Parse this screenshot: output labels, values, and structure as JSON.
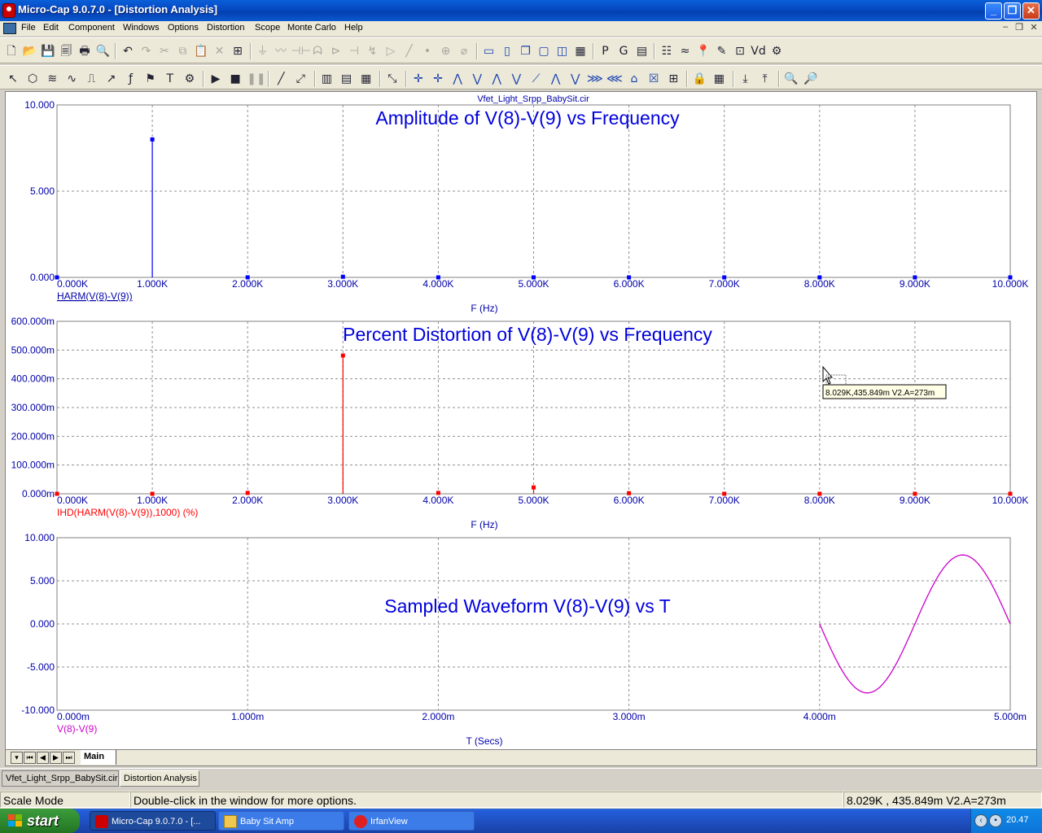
{
  "window": {
    "title": "Micro-Cap 9.0.7.0 - [Distortion Analysis]",
    "controls": {
      "minimize": "_",
      "maximize": "❐",
      "close": "✕"
    }
  },
  "menu": {
    "items": [
      "File",
      "Edit",
      "Component",
      "Windows",
      "Options",
      "Distortion",
      "Scope",
      "Monte Carlo",
      "Help"
    ],
    "mdi_controls": [
      "‒",
      "❐",
      "✕"
    ]
  },
  "toolbar1": {
    "icons": [
      "new-file-icon",
      "open-folder-icon",
      "save-icon",
      "save-all-icon",
      "print-icon",
      "print-preview-icon",
      "undo-icon",
      "redo-icon",
      "cut-icon",
      "copy-icon",
      "paste-icon",
      "delete-icon",
      "select-all-icon",
      "ground-icon",
      "resistor-icon",
      "capacitor-icon",
      "inductor-icon",
      "diode-icon",
      "battery-icon",
      "npn-icon",
      "opamp-icon",
      "wire-icon",
      "dot-icon",
      "source-icon",
      "probe-icon",
      "tile-horizontal-icon",
      "tile-vertical-icon",
      "cascade-icon",
      "window-icon",
      "window-split-icon",
      "calculator-icon",
      "properties-p-icon",
      "grid-g-icon",
      "window-list-icon",
      "netlist-icon",
      "waveform-icon",
      "pin-icon",
      "pencil-icon",
      "zoom-window-icon",
      "vd-icon",
      "settings-icon"
    ],
    "glyphs": [
      "🗋",
      "📂",
      "💾",
      "🗐",
      "🖶",
      "🔍",
      "↶",
      "↷",
      "✂",
      "⧉",
      "📋",
      "✕",
      "⊞",
      "⏚",
      "〰",
      "⊣⊢",
      "ᗣ",
      "⊳",
      "⊣",
      "↯",
      "▷",
      "╱",
      "•",
      "⊕",
      "⌀",
      "▭",
      "▯",
      "❐",
      "▢",
      "◫",
      "▦",
      "P",
      "G",
      "▤",
      "☷",
      "≈",
      "📍",
      "✎",
      "⊡",
      "Vd",
      "⚙"
    ]
  },
  "toolbar2": {
    "icons": [
      "select-arrow-icon",
      "component-icon",
      "waveform-ops-icon",
      "spectrum-icon",
      "step-icon",
      "analysis-icon",
      "fft-icon",
      "mode-icon",
      "text-icon",
      "properties-icon",
      "run-icon",
      "stop-icon",
      "pause-icon",
      "line-icon",
      "line-arrow-icon",
      "grid1-icon",
      "grid2-icon",
      "grid3-icon",
      "auto-scale-icon",
      "cursor1-icon",
      "cursor2-icon",
      "cursor3-icon",
      "cursor4-icon",
      "tracking-icon",
      "peak-icon",
      "valley-icon",
      "high-icon",
      "low-icon",
      "inflection-icon",
      "slope-icon",
      "top-icon",
      "bottom-icon",
      "global-icon",
      "lock-icon",
      "table-icon",
      "cursor-mode-icon",
      "data-point-icon",
      "zoom-in-icon",
      "zoom-out-icon"
    ],
    "glyphs": [
      "↖",
      "⬡",
      "≋",
      "∿",
      "⎍",
      "↗",
      "ƒ",
      "⚑",
      "T",
      "⚙",
      "▶",
      "■",
      "❚❚",
      "╱",
      "⤢",
      "▥",
      "▤",
      "▦",
      "⤡",
      "✛",
      "✛",
      "⋀",
      "⋁",
      "⋀",
      "⋁",
      "⟋",
      "⋀",
      "⋁",
      "⋙",
      "⋘",
      "⌂",
      "☒",
      "⊞",
      "🔒",
      "▦",
      "⤓",
      "⤒",
      "🔍",
      "🔎"
    ]
  },
  "plot": {
    "file_name": "Vfet_Light_Srpp_BabySit.cir",
    "panels": [
      {
        "id": "amplitude",
        "title": "Amplitude of V(8)-V(9) vs Frequency",
        "trace_label": "HARM(V(8)-V(9))",
        "trace_color": "#0000ff",
        "x_title": "F (Hz)",
        "y_ticks": [
          "10.000",
          "5.000",
          "0.000"
        ],
        "x_ticks": [
          "0.000K",
          "1.000K",
          "2.000K",
          "3.000K",
          "4.000K",
          "5.000K",
          "6.000K",
          "7.000K",
          "8.000K",
          "9.000K",
          "10.000K"
        ]
      },
      {
        "id": "distortion",
        "title": "Percent Distortion of V(8)-V(9) vs Frequency",
        "trace_label": "IHD(HARM(V(8)-V(9)),1000) (%)",
        "trace_color": "#ff0000",
        "x_title": "F (Hz)",
        "y_ticks": [
          "600.000m",
          "500.000m",
          "400.000m",
          "300.000m",
          "200.000m",
          "100.000m",
          "0.000m"
        ],
        "x_ticks": [
          "0.000K",
          "1.000K",
          "2.000K",
          "3.000K",
          "4.000K",
          "5.000K",
          "6.000K",
          "7.000K",
          "8.000K",
          "9.000K",
          "10.000K"
        ]
      },
      {
        "id": "waveform",
        "title": "Sampled Waveform  V(8)-V(9) vs T",
        "trace_label": "V(8)-V(9)",
        "trace_color": "#cc00cc",
        "x_title": "T (Secs)",
        "y_ticks": [
          "10.000",
          "5.000",
          "0.000",
          "-5.000",
          "-10.000"
        ],
        "x_ticks": [
          "0.000m",
          "1.000m",
          "2.000m",
          "3.000m",
          "4.000m",
          "5.000m"
        ]
      }
    ],
    "tooltip": "8.029K,435.849m V2.A=273m"
  },
  "chart_data": [
    {
      "type": "bar",
      "title": "Amplitude of V(8)-V(9) vs Frequency",
      "xlabel": "F (Hz)",
      "ylabel": "",
      "x_unit": "K",
      "xlim": [
        0,
        10000
      ],
      "ylim": [
        0,
        10
      ],
      "grid": true,
      "series": [
        {
          "name": "HARM(V(8)-V(9))",
          "x": [
            0,
            1000,
            2000,
            3000,
            4000,
            5000,
            6000,
            7000,
            8000,
            9000,
            10000
          ],
          "values": [
            0,
            8.0,
            0.003,
            0.038,
            0.001,
            0.002,
            0.0,
            0.0,
            0.0,
            0.0,
            0.0
          ]
        }
      ]
    },
    {
      "type": "bar",
      "title": "Percent Distortion of V(8)-V(9) vs Frequency",
      "xlabel": "F (Hz)",
      "ylabel": "",
      "xlim": [
        0,
        10000
      ],
      "ylim": [
        0,
        0.6
      ],
      "grid": true,
      "series": [
        {
          "name": "IHD(HARM(V(8)-V(9)),1000) (%)",
          "x": [
            0,
            1000,
            2000,
            3000,
            4000,
            5000,
            6000,
            7000,
            8000,
            9000,
            10000
          ],
          "values": [
            0,
            0,
            0.003,
            0.481,
            0.003,
            0.022,
            0.002,
            0.0,
            0.0,
            0.0,
            0.0
          ]
        }
      ]
    },
    {
      "type": "line",
      "title": "Sampled Waveform  V(8)-V(9) vs T",
      "xlabel": "T (Secs)",
      "ylabel": "",
      "xlim": [
        0,
        0.005
      ],
      "ylim": [
        -10,
        10
      ],
      "grid": true,
      "series": [
        {
          "name": "V(8)-V(9)",
          "x": [
            0.004,
            0.0041,
            0.0042,
            0.00425,
            0.0043,
            0.0044,
            0.0045,
            0.0046,
            0.0047,
            0.00475,
            0.0048,
            0.0049,
            0.005
          ],
          "values": [
            0,
            -4.7,
            -7.6,
            -8.0,
            -7.6,
            -4.7,
            0,
            4.7,
            7.6,
            8.0,
            7.6,
            4.7,
            0
          ]
        }
      ]
    }
  ],
  "sheet": {
    "active_tab": "Main",
    "nav": [
      "▾",
      "⏮",
      "◀",
      "▶",
      "⏭"
    ]
  },
  "mdi_tabs": [
    "Vfet_Light_Srpp_BabySit.cir",
    "Distortion Analysis"
  ],
  "status": {
    "mode": "Scale Mode",
    "hint": "Double-click in the window for more options.",
    "readout": "8.029K , 435.849m  V2.A=273m"
  },
  "taskbar": {
    "start_label": "start",
    "tasks": [
      "Micro-Cap 9.0.7.0 - [...",
      "Baby Sit Amp",
      "IrfanView"
    ],
    "clock": "20.47"
  }
}
